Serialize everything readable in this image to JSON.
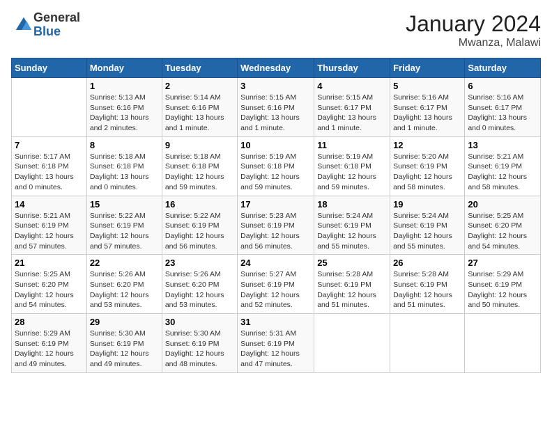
{
  "logo": {
    "general": "General",
    "blue": "Blue"
  },
  "title": {
    "month_year": "January 2024",
    "location": "Mwanza, Malawi"
  },
  "calendar": {
    "headers": [
      "Sunday",
      "Monday",
      "Tuesday",
      "Wednesday",
      "Thursday",
      "Friday",
      "Saturday"
    ],
    "weeks": [
      [
        {
          "day": "",
          "sunrise": "",
          "sunset": "",
          "daylight": ""
        },
        {
          "day": "1",
          "sunrise": "Sunrise: 5:13 AM",
          "sunset": "Sunset: 6:16 PM",
          "daylight": "Daylight: 13 hours and 2 minutes."
        },
        {
          "day": "2",
          "sunrise": "Sunrise: 5:14 AM",
          "sunset": "Sunset: 6:16 PM",
          "daylight": "Daylight: 13 hours and 1 minute."
        },
        {
          "day": "3",
          "sunrise": "Sunrise: 5:15 AM",
          "sunset": "Sunset: 6:16 PM",
          "daylight": "Daylight: 13 hours and 1 minute."
        },
        {
          "day": "4",
          "sunrise": "Sunrise: 5:15 AM",
          "sunset": "Sunset: 6:17 PM",
          "daylight": "Daylight: 13 hours and 1 minute."
        },
        {
          "day": "5",
          "sunrise": "Sunrise: 5:16 AM",
          "sunset": "Sunset: 6:17 PM",
          "daylight": "Daylight: 13 hours and 1 minute."
        },
        {
          "day": "6",
          "sunrise": "Sunrise: 5:16 AM",
          "sunset": "Sunset: 6:17 PM",
          "daylight": "Daylight: 13 hours and 0 minutes."
        }
      ],
      [
        {
          "day": "7",
          "sunrise": "Sunrise: 5:17 AM",
          "sunset": "Sunset: 6:18 PM",
          "daylight": "Daylight: 13 hours and 0 minutes."
        },
        {
          "day": "8",
          "sunrise": "Sunrise: 5:18 AM",
          "sunset": "Sunset: 6:18 PM",
          "daylight": "Daylight: 13 hours and 0 minutes."
        },
        {
          "day": "9",
          "sunrise": "Sunrise: 5:18 AM",
          "sunset": "Sunset: 6:18 PM",
          "daylight": "Daylight: 12 hours and 59 minutes."
        },
        {
          "day": "10",
          "sunrise": "Sunrise: 5:19 AM",
          "sunset": "Sunset: 6:18 PM",
          "daylight": "Daylight: 12 hours and 59 minutes."
        },
        {
          "day": "11",
          "sunrise": "Sunrise: 5:19 AM",
          "sunset": "Sunset: 6:18 PM",
          "daylight": "Daylight: 12 hours and 59 minutes."
        },
        {
          "day": "12",
          "sunrise": "Sunrise: 5:20 AM",
          "sunset": "Sunset: 6:19 PM",
          "daylight": "Daylight: 12 hours and 58 minutes."
        },
        {
          "day": "13",
          "sunrise": "Sunrise: 5:21 AM",
          "sunset": "Sunset: 6:19 PM",
          "daylight": "Daylight: 12 hours and 58 minutes."
        }
      ],
      [
        {
          "day": "14",
          "sunrise": "Sunrise: 5:21 AM",
          "sunset": "Sunset: 6:19 PM",
          "daylight": "Daylight: 12 hours and 57 minutes."
        },
        {
          "day": "15",
          "sunrise": "Sunrise: 5:22 AM",
          "sunset": "Sunset: 6:19 PM",
          "daylight": "Daylight: 12 hours and 57 minutes."
        },
        {
          "day": "16",
          "sunrise": "Sunrise: 5:22 AM",
          "sunset": "Sunset: 6:19 PM",
          "daylight": "Daylight: 12 hours and 56 minutes."
        },
        {
          "day": "17",
          "sunrise": "Sunrise: 5:23 AM",
          "sunset": "Sunset: 6:19 PM",
          "daylight": "Daylight: 12 hours and 56 minutes."
        },
        {
          "day": "18",
          "sunrise": "Sunrise: 5:24 AM",
          "sunset": "Sunset: 6:19 PM",
          "daylight": "Daylight: 12 hours and 55 minutes."
        },
        {
          "day": "19",
          "sunrise": "Sunrise: 5:24 AM",
          "sunset": "Sunset: 6:19 PM",
          "daylight": "Daylight: 12 hours and 55 minutes."
        },
        {
          "day": "20",
          "sunrise": "Sunrise: 5:25 AM",
          "sunset": "Sunset: 6:20 PM",
          "daylight": "Daylight: 12 hours and 54 minutes."
        }
      ],
      [
        {
          "day": "21",
          "sunrise": "Sunrise: 5:25 AM",
          "sunset": "Sunset: 6:20 PM",
          "daylight": "Daylight: 12 hours and 54 minutes."
        },
        {
          "day": "22",
          "sunrise": "Sunrise: 5:26 AM",
          "sunset": "Sunset: 6:20 PM",
          "daylight": "Daylight: 12 hours and 53 minutes."
        },
        {
          "day": "23",
          "sunrise": "Sunrise: 5:26 AM",
          "sunset": "Sunset: 6:20 PM",
          "daylight": "Daylight: 12 hours and 53 minutes."
        },
        {
          "day": "24",
          "sunrise": "Sunrise: 5:27 AM",
          "sunset": "Sunset: 6:19 PM",
          "daylight": "Daylight: 12 hours and 52 minutes."
        },
        {
          "day": "25",
          "sunrise": "Sunrise: 5:28 AM",
          "sunset": "Sunset: 6:19 PM",
          "daylight": "Daylight: 12 hours and 51 minutes."
        },
        {
          "day": "26",
          "sunrise": "Sunrise: 5:28 AM",
          "sunset": "Sunset: 6:19 PM",
          "daylight": "Daylight: 12 hours and 51 minutes."
        },
        {
          "day": "27",
          "sunrise": "Sunrise: 5:29 AM",
          "sunset": "Sunset: 6:19 PM",
          "daylight": "Daylight: 12 hours and 50 minutes."
        }
      ],
      [
        {
          "day": "28",
          "sunrise": "Sunrise: 5:29 AM",
          "sunset": "Sunset: 6:19 PM",
          "daylight": "Daylight: 12 hours and 49 minutes."
        },
        {
          "day": "29",
          "sunrise": "Sunrise: 5:30 AM",
          "sunset": "Sunset: 6:19 PM",
          "daylight": "Daylight: 12 hours and 49 minutes."
        },
        {
          "day": "30",
          "sunrise": "Sunrise: 5:30 AM",
          "sunset": "Sunset: 6:19 PM",
          "daylight": "Daylight: 12 hours and 48 minutes."
        },
        {
          "day": "31",
          "sunrise": "Sunrise: 5:31 AM",
          "sunset": "Sunset: 6:19 PM",
          "daylight": "Daylight: 12 hours and 47 minutes."
        },
        {
          "day": "",
          "sunrise": "",
          "sunset": "",
          "daylight": ""
        },
        {
          "day": "",
          "sunrise": "",
          "sunset": "",
          "daylight": ""
        },
        {
          "day": "",
          "sunrise": "",
          "sunset": "",
          "daylight": ""
        }
      ]
    ]
  }
}
